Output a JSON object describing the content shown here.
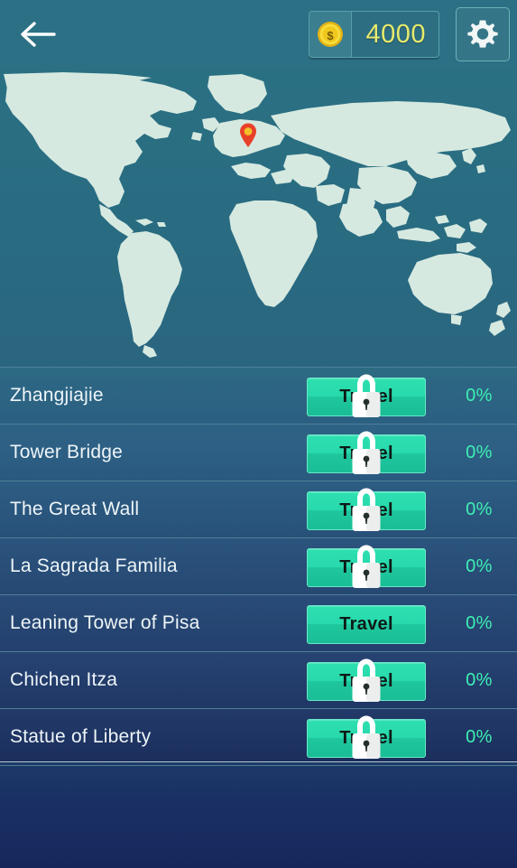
{
  "topbar": {
    "back_icon": "arrow-left-icon",
    "coin_icon": "coin-dollar-icon",
    "coin_amount": "4000",
    "settings_icon": "gear-icon"
  },
  "map": {
    "marker_icon": "map-pin-icon",
    "marker_label": "Leaning Tower of Pisa",
    "ocean_color": "#2a7083",
    "land_color": "#d6e9e0",
    "marker_color": "#e8412a"
  },
  "colors": {
    "row_background": "#2e6687",
    "row_divider": "#4d8098",
    "travel_button": "#23d3a5",
    "percent_text": "#3ef0b4",
    "coin_text": "#e7ea6d",
    "topbar": "#2b7084",
    "bottom_gradient_start": "#1d3a6a",
    "bottom_gradient_end": "#16265a"
  },
  "list": {
    "travel_label": "Travel",
    "lock_icon": "lock-icon",
    "rows": [
      {
        "name": "Zhangjiajie",
        "button": "Travel",
        "percent": "0%",
        "locked": true
      },
      {
        "name": "Tower Bridge",
        "button": "Travel",
        "percent": "0%",
        "locked": true
      },
      {
        "name": "The Great Wall",
        "button": "Travel",
        "percent": "0%",
        "locked": true
      },
      {
        "name": "La Sagrada Familia",
        "button": "Travel",
        "percent": "0%",
        "locked": true
      },
      {
        "name": "Leaning Tower of Pisa",
        "button": "Travel",
        "percent": "0%",
        "locked": false
      },
      {
        "name": "Chichen Itza",
        "button": "Travel",
        "percent": "0%",
        "locked": true
      },
      {
        "name": "Statue of Liberty",
        "button": "Travel",
        "percent": "0%",
        "locked": true
      }
    ]
  }
}
